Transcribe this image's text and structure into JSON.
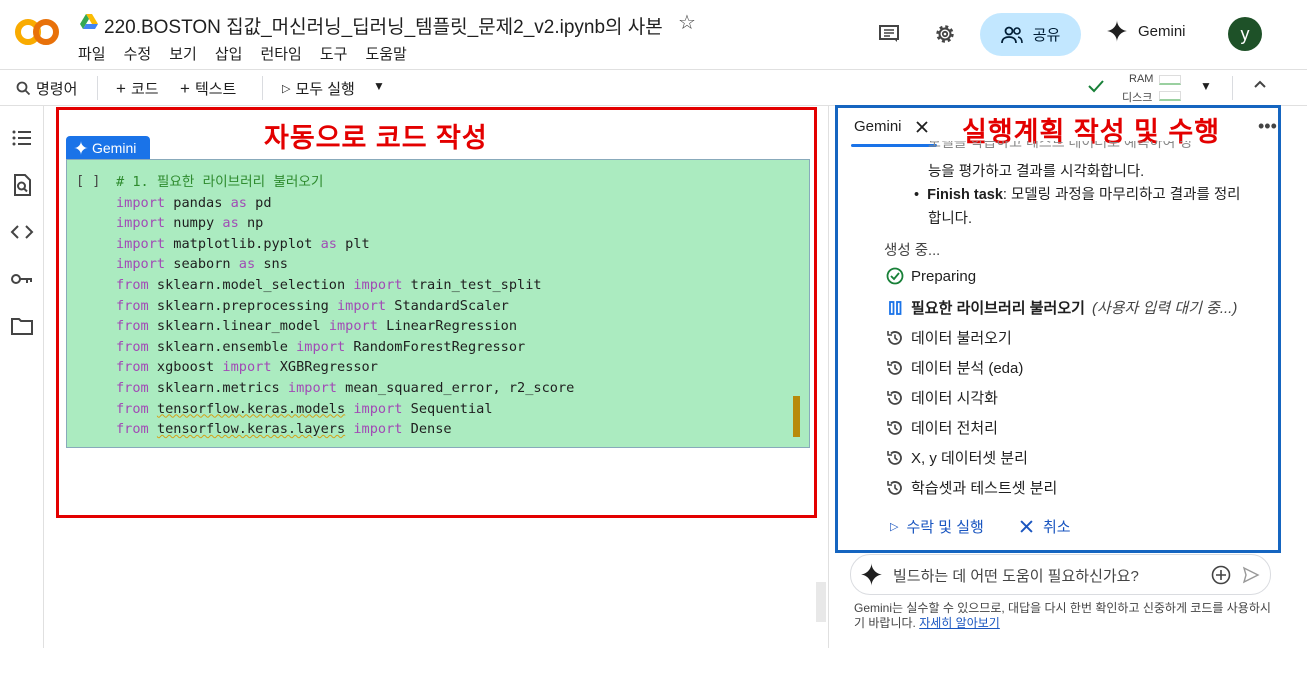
{
  "header": {
    "doc_title": "220.BOSTON 집값_머신러닝_딥러닝_템플릿_문제2_v2.ipynb의 사본",
    "menu": [
      "파일",
      "수정",
      "보기",
      "삽입",
      "런타임",
      "도구",
      "도움말"
    ],
    "share_label": "공유",
    "gemini_label": "Gemini",
    "avatar_letter": "y"
  },
  "toolbar": {
    "commands": "명령어",
    "code": "코드",
    "text": "텍스트",
    "run_all": "모두 실행",
    "ram": "RAM",
    "disk": "디스크"
  },
  "notebook": {
    "annotation": "자동으로 코드 작성",
    "gemini_tag": "Gemini",
    "run_brackets": "[ ]",
    "code": [
      [
        {
          "t": "# 1. 필요한 라이브러리 불러오기",
          "c": "cm"
        }
      ],
      [
        {
          "t": "import",
          "c": "kw"
        },
        {
          "t": " pandas "
        },
        {
          "t": "as",
          "c": "kw"
        },
        {
          "t": " pd"
        }
      ],
      [
        {
          "t": "import",
          "c": "kw"
        },
        {
          "t": " numpy "
        },
        {
          "t": "as",
          "c": "kw"
        },
        {
          "t": " np"
        }
      ],
      [
        {
          "t": "import",
          "c": "kw"
        },
        {
          "t": " matplotlib.pyplot "
        },
        {
          "t": "as",
          "c": "kw"
        },
        {
          "t": " plt"
        }
      ],
      [
        {
          "t": "import",
          "c": "kw"
        },
        {
          "t": " seaborn "
        },
        {
          "t": "as",
          "c": "kw"
        },
        {
          "t": " sns"
        }
      ],
      [
        {
          "t": "from",
          "c": "kw"
        },
        {
          "t": " sklearn.model_selection "
        },
        {
          "t": "import",
          "c": "kw"
        },
        {
          "t": " train_test_split"
        }
      ],
      [
        {
          "t": "from",
          "c": "kw"
        },
        {
          "t": " sklearn.preprocessing "
        },
        {
          "t": "import",
          "c": "kw"
        },
        {
          "t": " StandardScaler"
        }
      ],
      [
        {
          "t": "from",
          "c": "kw"
        },
        {
          "t": " sklearn.linear_model "
        },
        {
          "t": "import",
          "c": "kw"
        },
        {
          "t": " LinearRegression"
        }
      ],
      [
        {
          "t": "from",
          "c": "kw"
        },
        {
          "t": " sklearn.ensemble "
        },
        {
          "t": "import",
          "c": "kw"
        },
        {
          "t": " RandomForestRegressor"
        }
      ],
      [
        {
          "t": "from",
          "c": "kw"
        },
        {
          "t": " xgboost "
        },
        {
          "t": "import",
          "c": "kw"
        },
        {
          "t": " XGBRegressor"
        }
      ],
      [
        {
          "t": "from",
          "c": "kw"
        },
        {
          "t": " sklearn.metrics "
        },
        {
          "t": "import",
          "c": "kw"
        },
        {
          "t": " mean_squared_error, r2_score"
        }
      ],
      [
        {
          "t": "from",
          "c": "kw"
        },
        {
          "t": " "
        },
        {
          "t": "tensorflow.keras.models",
          "c": "sq"
        },
        {
          "t": " "
        },
        {
          "t": "import",
          "c": "kw"
        },
        {
          "t": " Sequential"
        }
      ],
      [
        {
          "t": "from",
          "c": "kw"
        },
        {
          "t": " "
        },
        {
          "t": "tensorflow.keras.layers",
          "c": "sq"
        },
        {
          "t": " "
        },
        {
          "t": "import",
          "c": "kw"
        },
        {
          "t": " Dense"
        }
      ]
    ]
  },
  "gemini_panel": {
    "tab_label": "Gemini",
    "annotation": "실행계획 작성 및 수행",
    "partial_text": "모델을 학습하고 테스트 데이터로 예측하여 성",
    "bullet1_cont": "능을 평가하고 결과를 시각화합니다.",
    "bullet2_bold": "Finish task",
    "bullet2_rest": ": 모델링 과정을 마무리하고 결과를 정리",
    "bullet2_cont": "합니다.",
    "status": "생성 중...",
    "steps": [
      {
        "label": "Preparing",
        "state": "done"
      },
      {
        "label": "필요한 라이브러리 불러오기",
        "state": "paused",
        "note": "(사용자 입력 대기 중...)"
      },
      {
        "label": "데이터 불러오기",
        "state": "pending"
      },
      {
        "label": "데이터 분석 (eda)",
        "state": "pending"
      },
      {
        "label": "데이터 시각화",
        "state": "pending"
      },
      {
        "label": "데이터 전처리",
        "state": "pending"
      },
      {
        "label": "X, y 데이터셋 분리",
        "state": "pending"
      },
      {
        "label": "학습셋과 테스트셋 분리",
        "state": "pending"
      }
    ],
    "accept_label": "수락 및 실행",
    "cancel_label": "취소",
    "prompt_placeholder": "빌드하는 데 어떤 도움이 필요하신가요?",
    "disclaimer": "Gemini는 실수할 수 있으므로, 대답을 다시 한번 확인하고 신중하게 코드를 사용하시기 바랍니다.",
    "learn_more": "자세히 알아보기"
  },
  "colors": {
    "annotation_red": "#e30000",
    "annotation_blue": "#1565c0",
    "cell_green": "#abebc0",
    "keyword": "#a14bb5",
    "comment": "#2e8b2e",
    "accent_blue": "#1a73e8"
  }
}
